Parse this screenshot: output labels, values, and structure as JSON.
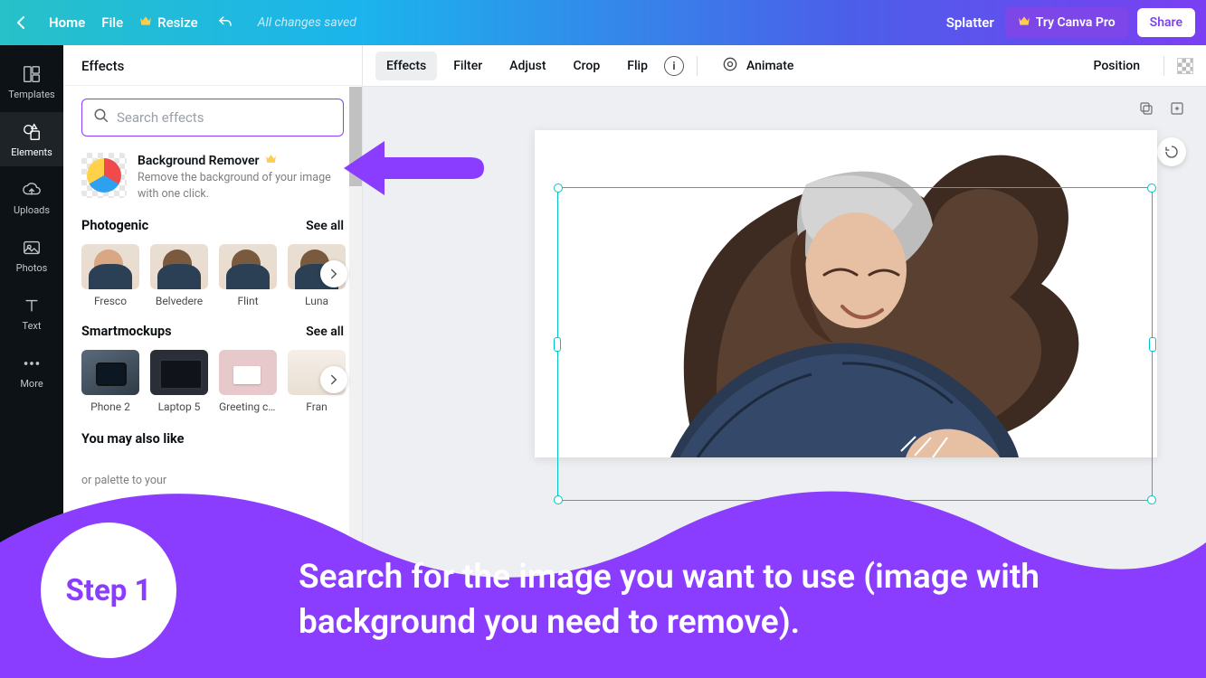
{
  "topbar": {
    "home": "Home",
    "file": "File",
    "resize": "Resize",
    "saved": "All changes saved",
    "doc_name": "Splatter",
    "try_pro": "Try Canva Pro",
    "share": "Share"
  },
  "rail": {
    "items": [
      {
        "label": "Templates"
      },
      {
        "label": "Elements"
      },
      {
        "label": "Uploads"
      },
      {
        "label": "Photos"
      },
      {
        "label": "Text"
      },
      {
        "label": "More"
      }
    ]
  },
  "panel": {
    "heading": "Effects",
    "search_placeholder": "Search effects",
    "bg_remover": {
      "title": "Background Remover",
      "desc": "Remove the background of your image with one click."
    },
    "photogenic": {
      "title": "Photogenic",
      "seeall": "See all",
      "items": [
        "Fresco",
        "Belvedere",
        "Flint",
        "Luna"
      ]
    },
    "smartmockups": {
      "title": "Smartmockups",
      "seeall": "See all",
      "items": [
        "Phone 2",
        "Laptop 5",
        "Greeting car...",
        "Fran"
      ]
    },
    "yml_title": "You may also like",
    "yml_desc_fragment": "or palette to your"
  },
  "toolbar": {
    "effects": "Effects",
    "filter": "Filter",
    "adjust": "Adjust",
    "crop": "Crop",
    "flip": "Flip",
    "animate": "Animate",
    "position": "Position"
  },
  "tutorial": {
    "step_label": "Step 1",
    "text": "Search for the image you want to use (image with background you need to remove).",
    "accent_color": "#8b3dff"
  }
}
